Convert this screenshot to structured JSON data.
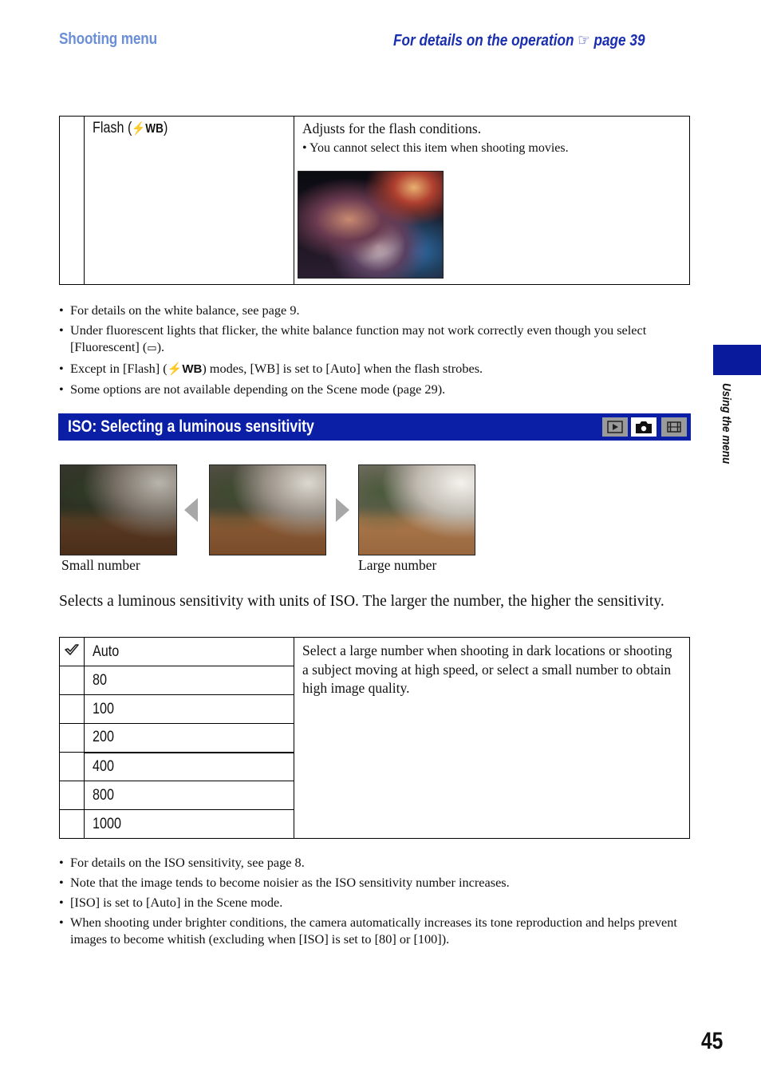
{
  "header": {
    "section": "Shooting menu",
    "crossref_prefix": "For details on the operation",
    "crossref_icon": "pointing-hand-icon",
    "crossref_page": "page 39"
  },
  "flash_table": {
    "item_label": "Flash (",
    "item_icon": "flash-wb-icon",
    "item_icon_text": "WB",
    "item_label_end": ")",
    "description": "Adjusts for the flash conditions.",
    "note": "You cannot select this item when shooting movies.",
    "image": "flash-sample-photo"
  },
  "wb_notes": [
    "For details on the white balance, see page 9.",
    "Under fluorescent lights that flicker, the white balance function may not work correctly even though you select [Fluorescent] (",
    "Except in [Flash] (",
    "Some options are not available depending on the Scene mode (page 29)."
  ],
  "wb_notes_tail": {
    "fluorescent_end": ").",
    "flash_end": ") modes, [WB] is set to [Auto] when the flash strobes.",
    "wb_text": "WB"
  },
  "iso_section": {
    "title": "ISO: Selecting a luminous sensitivity",
    "mode_icons": [
      {
        "name": "playback-icon",
        "active": false
      },
      {
        "name": "camera-icon",
        "active": true
      },
      {
        "name": "movie-icon",
        "active": false
      }
    ],
    "example_images": {
      "left_caption": "Small number",
      "right_caption": "Large number"
    },
    "intro": "Selects a luminous sensitivity with units of ISO. The larger the number, the higher the sensitivity.",
    "options": [
      {
        "label": "Auto",
        "default": true
      },
      {
        "label": "80",
        "default": false
      },
      {
        "label": "100",
        "default": false
      },
      {
        "label": "200",
        "default": false
      },
      {
        "label": "400",
        "default": false
      },
      {
        "label": "800",
        "default": false
      },
      {
        "label": "1000",
        "default": false
      }
    ],
    "options_description": "Select a large number when shooting in dark locations or shooting a subject moving at high speed, or select a small number to obtain high image quality.",
    "notes": [
      "For details on the ISO sensitivity, see page 8.",
      "Note that the image tends to become noisier as the ISO sensitivity number increases.",
      "[ISO] is set to [Auto] in the Scene mode.",
      "When shooting under brighter conditions, the camera automatically increases its tone reproduction and helps prevent images to become whitish (excluding when [ISO] is set to [80] or [100])."
    ]
  },
  "side_tab": "Using the menu",
  "page_number": "45",
  "colors": {
    "section_bar": "#0a1fa6",
    "header_left": "#6b8fd6",
    "header_right": "#1a2fb0",
    "side_tab": "#0a1a9c"
  }
}
